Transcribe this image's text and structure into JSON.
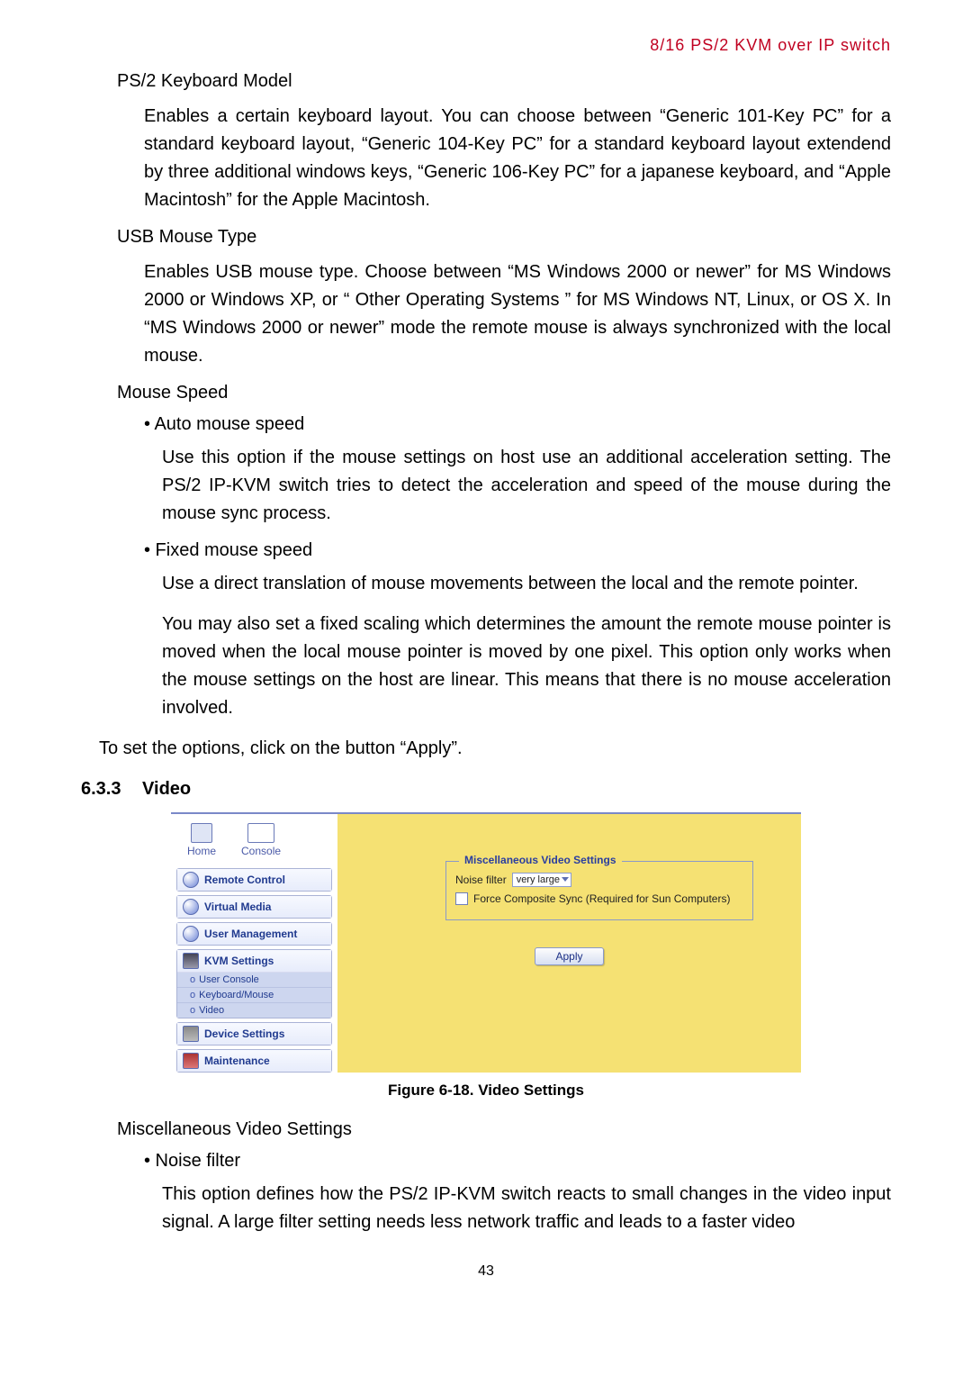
{
  "header": {
    "running_title": "8/16 PS/2 KVM over IP switch"
  },
  "sections": {
    "ps2_keyboard": {
      "title": "PS/2 Keyboard Model",
      "para": "Enables a certain keyboard layout. You can choose between “Generic 101-Key PC” for a standard keyboard layout, “Generic 104-Key PC” for a standard keyboard layout extendend by three additional windows keys, “Generic 106-Key PC” for a japanese keyboard, and “Apple Macintosh” for the Apple Macintosh."
    },
    "usb_mouse": {
      "title": "USB Mouse Type",
      "para": "Enables USB mouse type. Choose between “MS Windows 2000 or newer” for MS Windows 2000 or Windows XP, or “ Other Operating Systems ” for MS Windows NT, Linux, or OS X. In “MS Windows 2000 or newer” mode the remote mouse is always synchronized with the local mouse."
    },
    "mouse_speed": {
      "title": "Mouse Speed",
      "bullets": {
        "auto": {
          "label": "• Auto mouse speed",
          "para": "Use this option if the mouse settings on host use an additional acceleration setting. The PS/2 IP-KVM switch tries to detect the acceleration and speed of the mouse during the mouse sync process."
        },
        "fixed": {
          "label": "• Fixed mouse speed",
          "para1": "Use a direct translation of mouse movements between the local and the remote pointer.",
          "para2": "You may also set a fixed scaling which determines the amount the remote mouse pointer is moved when the local mouse pointer is moved by one pixel. This option only works when the mouse settings on the host are linear. This means that there is no mouse acceleration involved."
        }
      },
      "closing": "To set the options, click on the button “Apply”."
    },
    "video": {
      "number": "6.3.3",
      "title": "Video",
      "caption": "Figure 6-18. Video Settings",
      "misc_title": "Miscellaneous Video Settings",
      "noise_bullet": "•  Noise filter",
      "noise_para": "This option defines how the PS/2 IP-KVM switch reacts to small changes in the video input signal. A large filter setting needs less network traffic and leads to a faster video"
    }
  },
  "screenshot": {
    "toolbar": {
      "home": "Home",
      "console": "Console"
    },
    "nav": {
      "remote_control": "Remote Control",
      "virtual_media": "Virtual Media",
      "user_management": "User Management",
      "kvm_settings": "KVM Settings",
      "sub_user_console": "User Console",
      "sub_keyboard_mouse": "Keyboard/Mouse",
      "sub_video": "Video",
      "device_settings": "Device Settings",
      "maintenance": "Maintenance"
    },
    "panel": {
      "legend": "Miscellaneous Video Settings",
      "noise_label": "Noise filter",
      "noise_value": "very large",
      "force_sync": "Force Composite Sync (Required for Sun Computers)",
      "apply": "Apply"
    }
  },
  "page_number": "43"
}
